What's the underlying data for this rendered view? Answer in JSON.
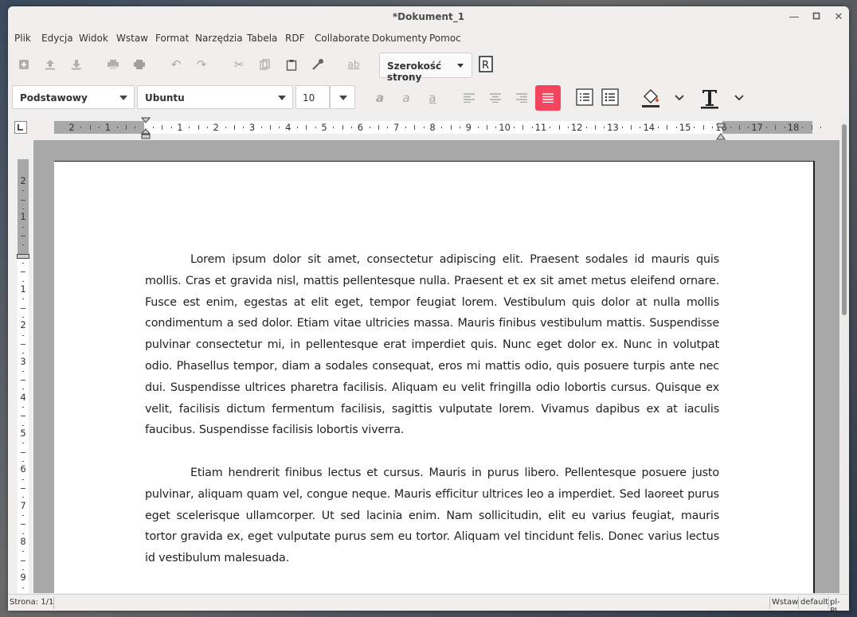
{
  "window": {
    "title": "*Dokument_1"
  },
  "menu": [
    "Plik",
    "Edycja",
    "Widok",
    "Wstaw",
    "Format",
    "Narzędzia",
    "Tabela",
    "RDF",
    "Collaborate",
    "Dokumenty",
    "Pomoc"
  ],
  "toolbar": {
    "zoom_label": "Szerokość strony",
    "icons": [
      "new-document-icon",
      "upload-icon",
      "download-icon",
      "print-preview-icon",
      "print-icon",
      "undo-icon",
      "redo-icon",
      "cut-icon",
      "copy-icon",
      "paste-icon",
      "clone-formatting-icon",
      "spellcheck-icon"
    ]
  },
  "format": {
    "paragraph_style": "Podstawowy",
    "font_name": "Ubuntu",
    "font_size": "10",
    "active_color": "#f4455f"
  },
  "ruler": {
    "h_labels": [
      "2",
      "1",
      "",
      "1",
      "2",
      "3",
      "4",
      "5",
      "6",
      "7",
      "8",
      "9",
      "10",
      "11",
      "12",
      "13",
      "14",
      "15",
      "16",
      "17",
      "18"
    ],
    "v_labels": [
      "2",
      "1",
      "",
      "1",
      "2",
      "3",
      "4",
      "5",
      "6",
      "7",
      "8",
      "9"
    ]
  },
  "document": {
    "paragraphs": [
      "Lorem ipsum dolor sit amet, consectetur adipiscing elit. Praesent sodales id mauris quis mollis. Cras et gravida nisl, mattis pellentesque nulla. Praesent et ex sit amet metus eleifend ornare. Fusce est enim, egestas at elit eget, tempor feugiat lorem. Vestibulum quis dolor at nulla mollis condimentum a sed dolor. Etiam vitae ultricies massa. Mauris finibus vestibulum mattis. Suspendisse pulvinar consectetur mi, in pellentesque erat imperdiet quis. Nunc eget dolor ex. Nunc in volutpat odio. Phasellus tempor, diam a sodales consequat, eros mi mattis odio, quis posuere turpis ante nec dui. Suspendisse ultrices pharetra facilisis. Aliquam eu velit fringilla odio lobortis cursus. Quisque ex velit, facilisis dictum fermentum facilisis, sagittis vulputate lorem. Vivamus dapibus ex at iaculis faucibus. Suspendisse facilisis lobortis viverra.",
      "Etiam hendrerit finibus lectus et cursus. Mauris in purus libero. Pellentesque posuere justo pulvinar, aliquam quam vel, congue neque. Mauris efficitur ultrices leo a imperdiet. Sed laoreet purus eget scelerisque ullamcorper. Ut sed lacinia enim. Nam sollicitudin, elit eu varius feugiat, mauris tortor gravida ex, eget vulputate purus sem eu tortor. Aliquam vel tincidunt felis. Donec varius lectus id vestibulum malesuada."
    ]
  },
  "status": {
    "page": "Strona: 1/1",
    "mode": "Wstaw",
    "style": "default",
    "lang": "pl-PL"
  }
}
